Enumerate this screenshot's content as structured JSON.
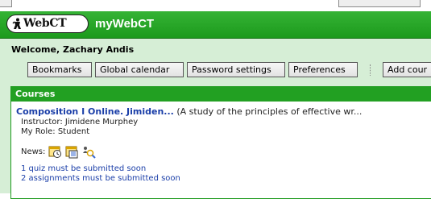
{
  "header": {
    "logo_text": "WebCT",
    "app_title": "myWebCT"
  },
  "welcome": "Welcome, Zachary Andis",
  "toolbar": {
    "bookmarks": "Bookmarks",
    "global_calendar": "Global calendar",
    "password_settings": "Password settings",
    "preferences": "Preferences",
    "add_course": "Add cour"
  },
  "courses": {
    "heading": "Courses",
    "items": [
      {
        "title": "Composition I Online. Jimiden...",
        "description": "(A study of the principles of effective wr...",
        "instructor": "Instructor: Jimidene Murphey",
        "role": "My Role: Student",
        "news_label": "News:",
        "notices": [
          "1 quiz must be submitted soon",
          "2 assignments must be submitted soon"
        ]
      }
    ]
  },
  "colors": {
    "header_green": "#1c9a1c",
    "panel_green": "#d6eed6",
    "link_blue": "#1a3ea8"
  },
  "icons": [
    "webct-figure-icon",
    "calendar-clock-icon",
    "calendar-grid-icon",
    "people-search-icon"
  ]
}
